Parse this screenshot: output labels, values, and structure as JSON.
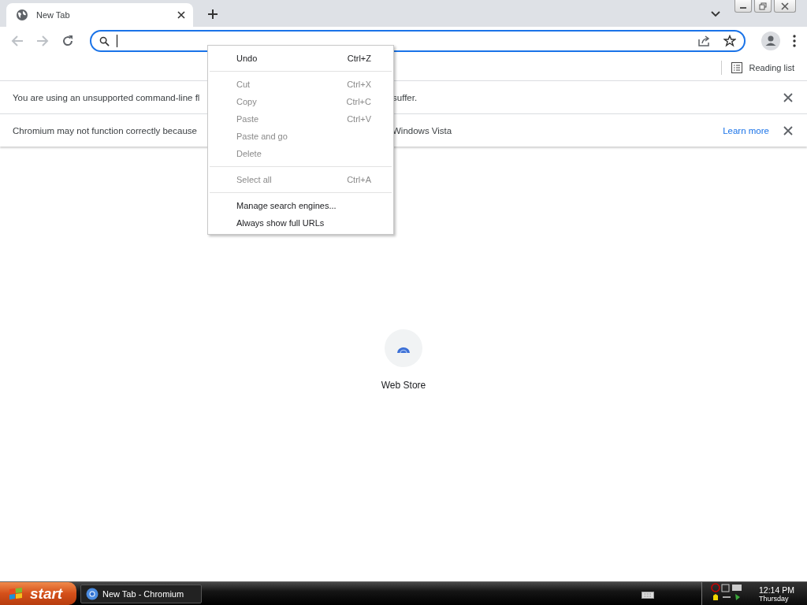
{
  "tabs": [
    {
      "title": "New Tab",
      "selected": true
    }
  ],
  "toolbar": {
    "buttons": [
      {
        "kind": "back",
        "disabled": true
      },
      {
        "kind": "forward",
        "disabled": true
      },
      {
        "kind": "reload",
        "disabled": false
      }
    ],
    "omnibox": {
      "focused": true
    }
  },
  "bookmarks_bar": {
    "reading_list": "Reading list"
  },
  "infobars": [
    {
      "text_parts": [
        "You are using an unsupported command-line fl",
        "suffer."
      ]
    },
    {
      "text_parts": [
        "Chromium may not function correctly because",
        "Windows Vista"
      ],
      "link": "Learn more"
    }
  ],
  "context_menu": [
    {
      "kind": "item",
      "label": "Undo",
      "shortcut": "Ctrl+Z",
      "disabled": false
    },
    {
      "kind": "separator"
    },
    {
      "kind": "item",
      "label": "Cut",
      "shortcut": "Ctrl+X",
      "disabled": true
    },
    {
      "kind": "item",
      "label": "Copy",
      "shortcut": "Ctrl+C",
      "disabled": true
    },
    {
      "kind": "item",
      "label": "Paste",
      "shortcut": "Ctrl+V",
      "disabled": true
    },
    {
      "kind": "item",
      "label": "Paste and go",
      "disabled": true
    },
    {
      "kind": "item",
      "label": "Delete",
      "disabled": true
    },
    {
      "kind": "separator"
    },
    {
      "kind": "item",
      "label": "Select all",
      "shortcut": "Ctrl+A",
      "disabled": true
    },
    {
      "kind": "separator"
    },
    {
      "kind": "item",
      "label": "Manage search engines...",
      "disabled": false
    },
    {
      "kind": "item",
      "label": "Always show full URLs",
      "disabled": false
    }
  ],
  "shortcuts": [
    {
      "title": "Web Store"
    }
  ],
  "taskbar": {
    "start": "start",
    "tasks": [
      {
        "title": "New Tab - Chromium"
      }
    ],
    "clock": {
      "time": "12:14 PM",
      "day": "Thursday"
    }
  }
}
